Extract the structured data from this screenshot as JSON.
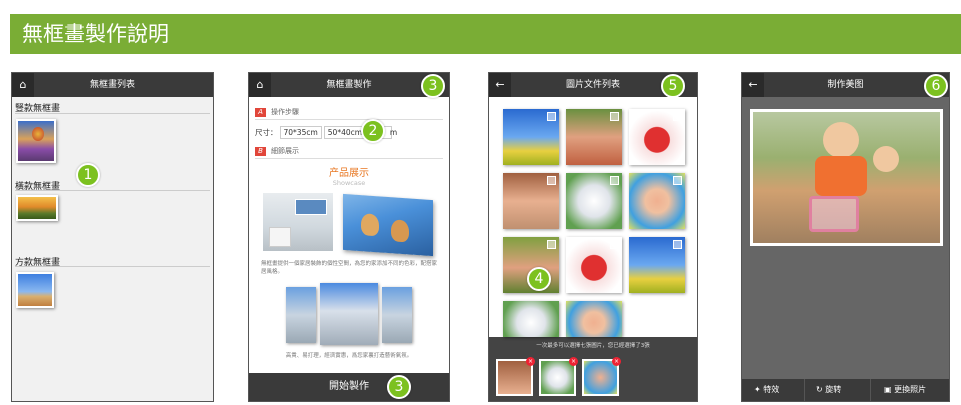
{
  "banner": {
    "title": "無框畫製作說明"
  },
  "badges": [
    "1",
    "2",
    "3",
    "4",
    "5",
    "6"
  ],
  "screen1": {
    "title": "無框畫列表",
    "categories": [
      "豎款無框畫",
      "橫款無框畫",
      "方款無框畫"
    ]
  },
  "screen2": {
    "title": "無框畫製作",
    "section_a_tag": "A",
    "section_a": "操作步驟",
    "size_label": "尺寸：",
    "sizes": [
      "70*35cm",
      "50*40cm",
      "6"
    ],
    "size_suffix": "m",
    "section_b_tag": "B",
    "section_b": "細節展示",
    "showcase_title": "产品展示",
    "showcase_sub": "Showcase",
    "desc1": "無框畫提供一個家居裝飾的個性空間，為您的家添加不同的色彩，配搭家居風格。",
    "desc2": "高貴、易打理，經濟實惠，爲您家裏打造藝術氣氛。",
    "start_button": "開始製作"
  },
  "screen3": {
    "title": "圖片文件列表",
    "note": "一次最多可以選擇七張圖片，您已經選擇了3張"
  },
  "screen4": {
    "title": "制作美图",
    "tools": [
      "特效",
      "旋转",
      "更換照片"
    ]
  },
  "icons": {
    "home": "home-icon",
    "back": "back-arrow-icon",
    "effects": "magic-wand-icon",
    "rotate": "rotate-icon",
    "replace": "replace-photo-icon"
  },
  "colors": {
    "banner": "#7aad35",
    "badge": "#7cc11f",
    "header": "#3a3a3a",
    "showcase": "#e87722",
    "tag": "#e1463a"
  }
}
